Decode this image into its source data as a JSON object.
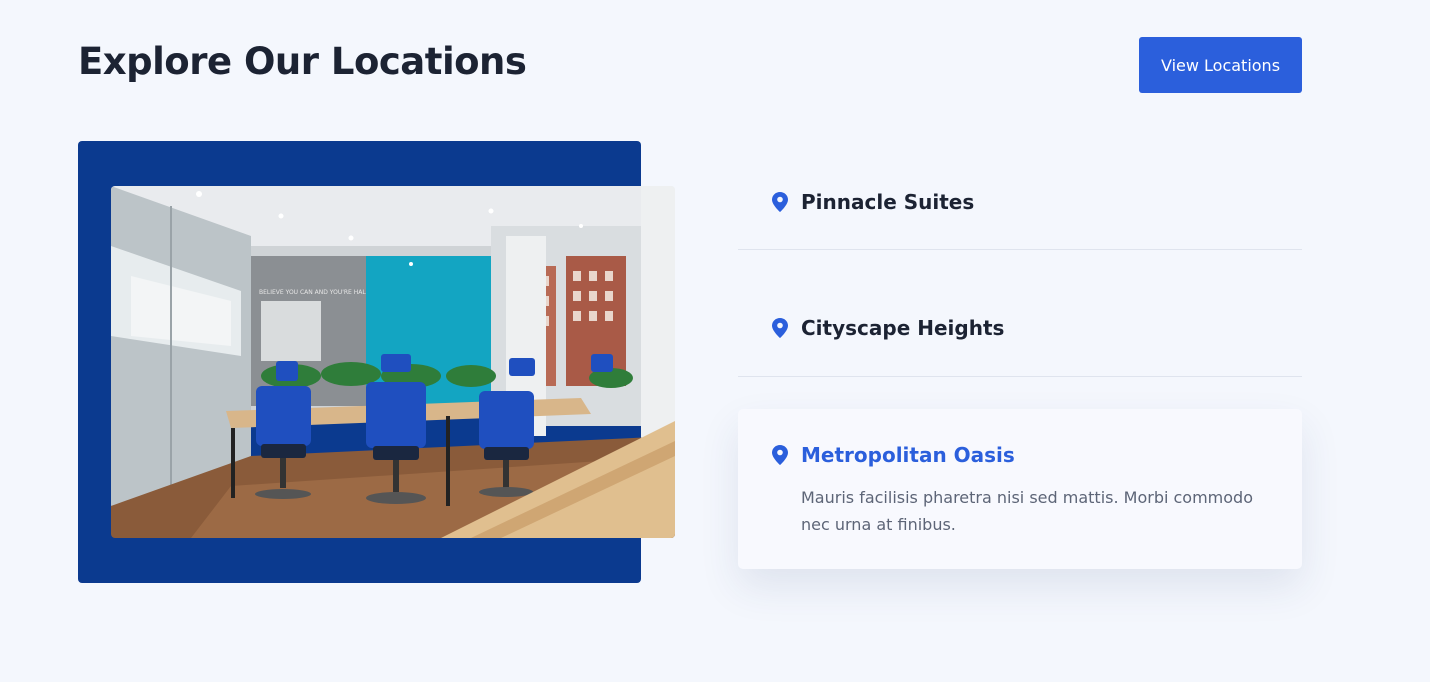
{
  "header": {
    "title": "Explore Our Locations",
    "cta_label": "View Locations"
  },
  "media": {
    "wall_slogan": "BELIEVE YOU CAN AND YOU'RE HALFWAY THERE"
  },
  "locations": [
    {
      "name": "Pinnacle Suites",
      "active": false
    },
    {
      "name": "Cityscape Heights",
      "active": false
    },
    {
      "name": "Metropolitan Oasis",
      "active": true,
      "description": "Mauris facilisis pharetra nisi sed mattis. Morbi commodo nec urna at finibus."
    }
  ],
  "icons": {
    "location": "map-pin-icon"
  },
  "colors": {
    "background": "#f4f7fd",
    "primary": "#2b5fdc",
    "frame": "#0b3a8f",
    "heading": "#1c2333",
    "body_text": "#5d6577"
  }
}
